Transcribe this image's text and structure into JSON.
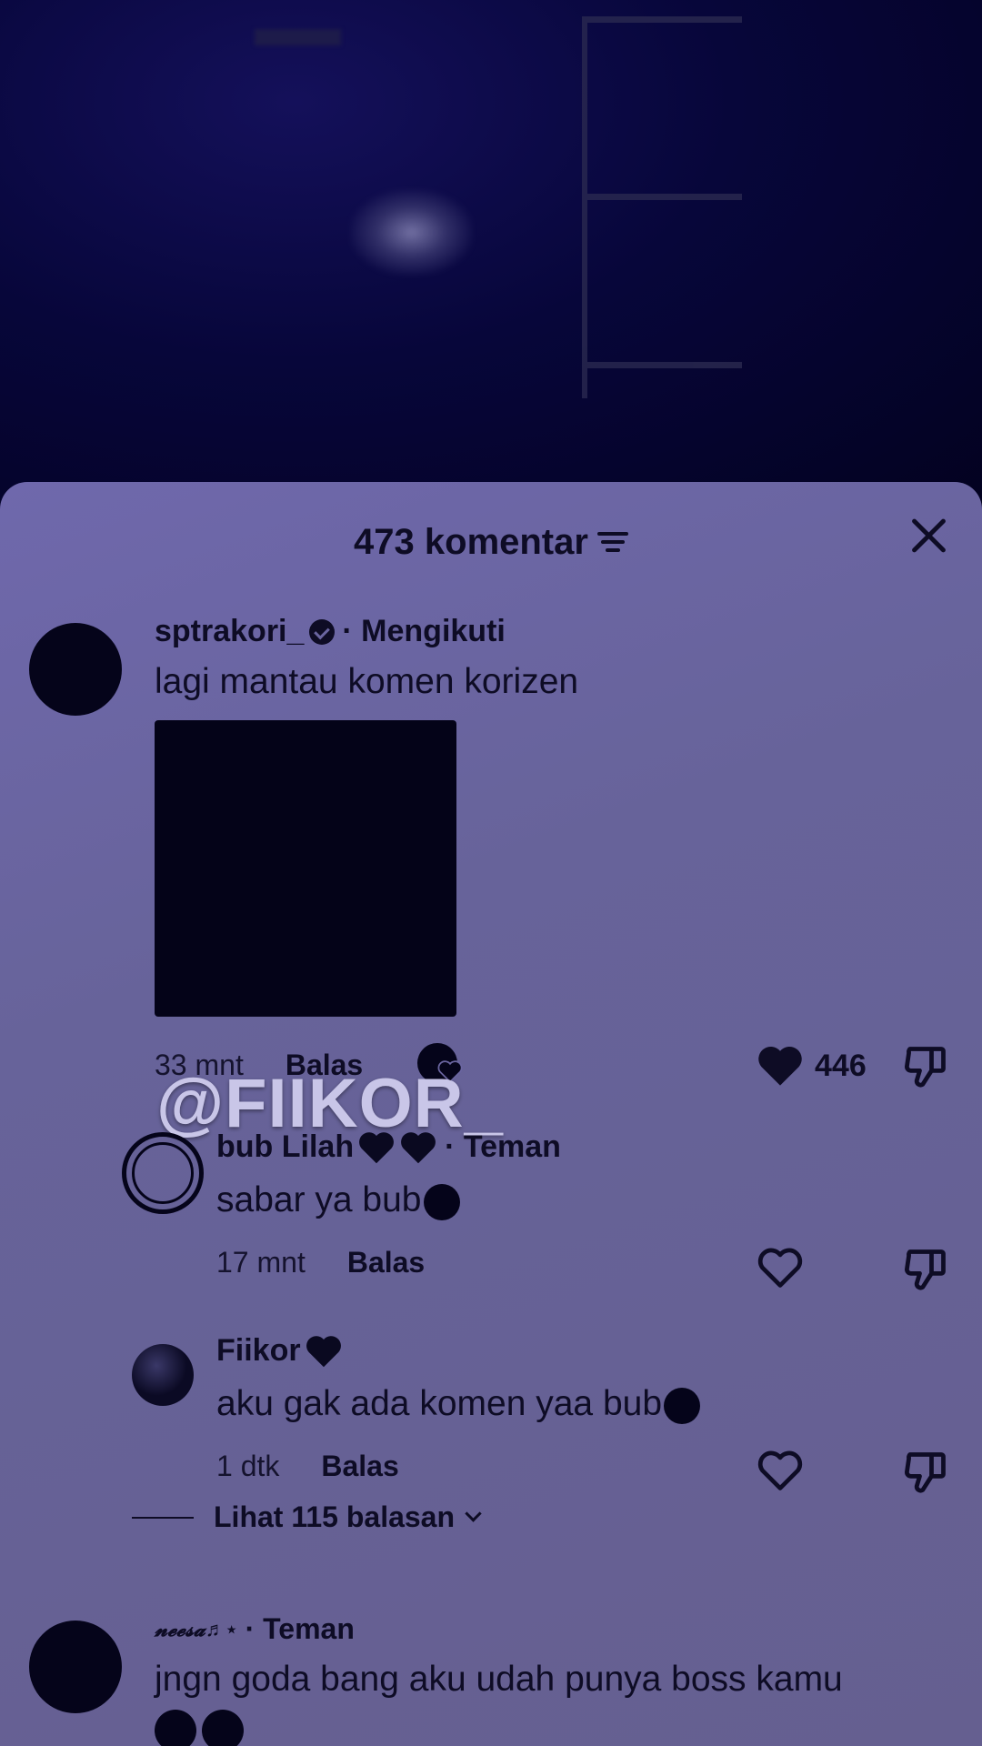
{
  "sheet": {
    "title": "473 komentar",
    "watermark": "@FIIKOR_"
  },
  "comments": [
    {
      "username": "sptrakori_",
      "relation": "· Mengikuti",
      "text": "lagi mantau komen korizen",
      "time": "33 mnt",
      "reply_label": "Balas",
      "likes": "446"
    }
  ],
  "replies": [
    {
      "username": "bub Lilah",
      "relation": "· Teman",
      "text": "sabar ya bub",
      "time": "17 mnt",
      "reply_label": "Balas"
    },
    {
      "username": "Fiikor",
      "text": "aku gak ada komen yaa bub",
      "time": "1 dtk",
      "reply_label": "Balas"
    }
  ],
  "view_replies_label": "Lihat 115 balasan",
  "next_comment": {
    "username": "𝓷𝓮𝓮𝓼𝓪♬⋆",
    "relation": "· Teman",
    "text": "jngn goda bang aku udah punya boss kamu"
  },
  "colors": {
    "sheet_bg": "#67639a",
    "text": "#0e0c25",
    "watermark": "#c9c6e8"
  }
}
